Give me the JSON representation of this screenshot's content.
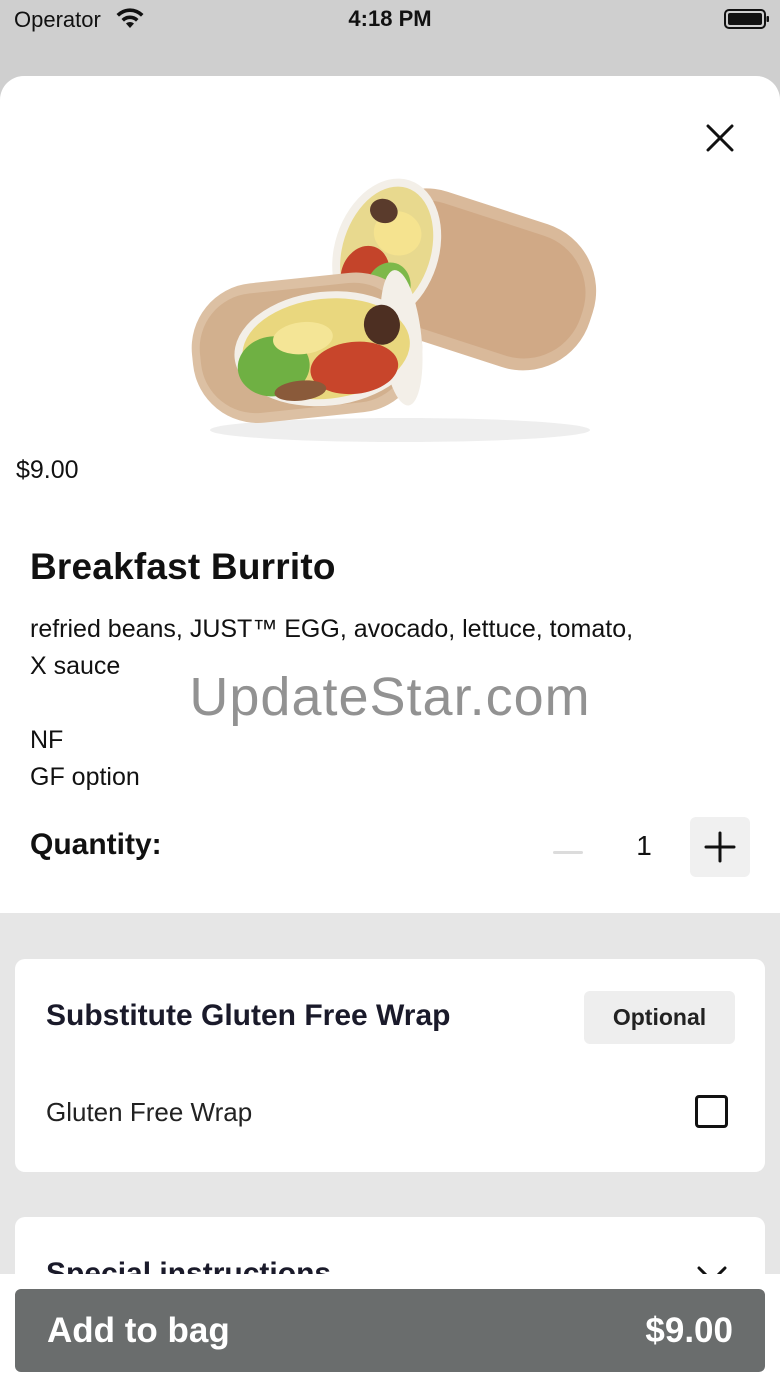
{
  "status_bar": {
    "carrier": "Operator",
    "time": "4:18 PM",
    "icons": [
      "wifi-icon",
      "battery-icon"
    ]
  },
  "item": {
    "price_display": "$9.00",
    "title": "Breakfast Burrito",
    "description_lines": [
      "refried beans, JUST™ EGG, avocado, lettuce, tomato,",
      "X sauce",
      "",
      "NF",
      "GF option"
    ],
    "image": "breakfast-burrito-photo"
  },
  "watermark": "UpdateStar.com",
  "quantity": {
    "label": "Quantity:",
    "value": "1",
    "decrement_icon": "minus-icon",
    "increment_icon": "plus-icon"
  },
  "modifier_group": {
    "title": "Substitute Gluten Free Wrap",
    "badge": "Optional",
    "options": [
      {
        "label": "Gluten Free Wrap",
        "checked": false
      }
    ]
  },
  "special_instructions": {
    "title": "Special instructions",
    "icon": "chevron-down-icon"
  },
  "add_to_bag": {
    "label": "Add to bag",
    "price": "$9.00"
  },
  "close_icon": "close-icon",
  "colors": {
    "add_button_bg": "#6a6d6d",
    "sheet_bg": "#ffffff",
    "section_bg": "#e6e6e6",
    "badge_bg": "#eeeeee"
  }
}
